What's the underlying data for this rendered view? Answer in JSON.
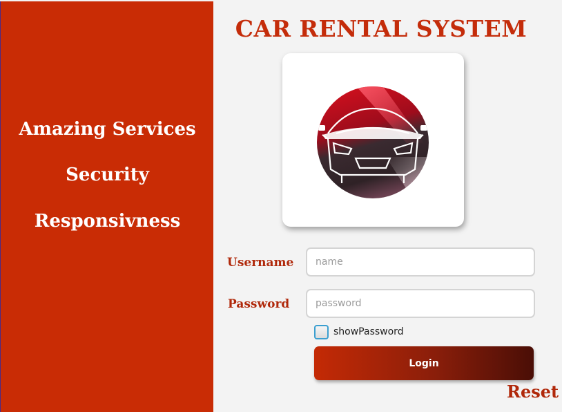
{
  "app": {
    "title": "CAR RENTAL SYSTEM"
  },
  "features": [
    "Amazing Services",
    "Security",
    "Responsivness"
  ],
  "logo": {
    "icon": "car-logo-icon"
  },
  "form": {
    "username_label": "Username",
    "username_placeholder": "name",
    "password_label": "Password",
    "password_placeholder": "password",
    "show_password_label": "showPassword",
    "show_password_checked": false,
    "login_label": "Login",
    "reset_label": "Reset"
  },
  "colors": {
    "brand": "#c92c05",
    "accent_text": "#b0280a",
    "button_dark": "#4a0e06"
  }
}
